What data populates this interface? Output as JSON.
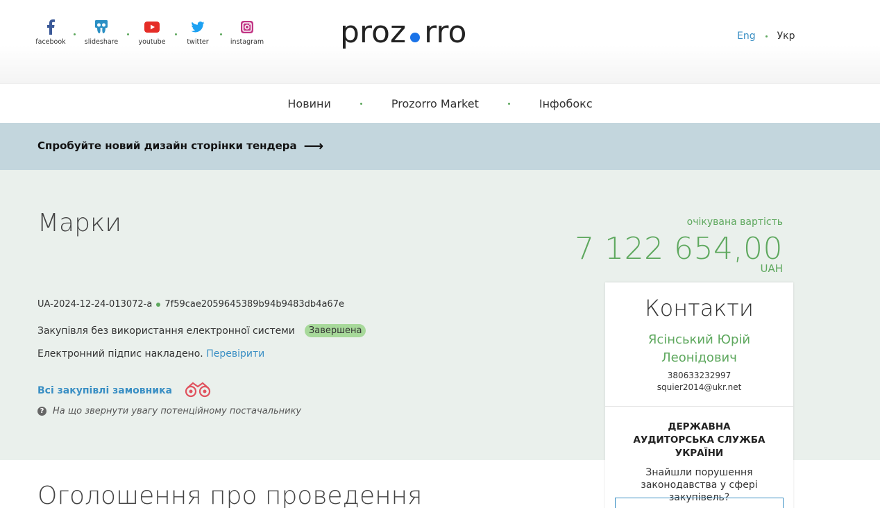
{
  "header": {
    "socials": [
      {
        "name": "facebook",
        "label": "facebook",
        "icon": "facebook-icon",
        "color": "#3b5998"
      },
      {
        "name": "slideshare",
        "label": "slideshare",
        "icon": "slideshare-icon",
        "color": "#2a8fc4"
      },
      {
        "name": "youtube",
        "label": "youtube",
        "icon": "youtube-icon",
        "color": "#e52d27"
      },
      {
        "name": "twitter",
        "label": "twitter",
        "icon": "twitter-icon",
        "color": "#1da1f2"
      },
      {
        "name": "instagram",
        "label": "instagram",
        "icon": "instagram-icon",
        "color": "#c13584"
      }
    ],
    "logo_left": "proz",
    "logo_right": "rro",
    "lang_en": "Eng",
    "lang_uk": "Укр"
  },
  "nav": {
    "items": [
      "Новини",
      "Prozorro Market",
      "Інфобокс"
    ]
  },
  "banner": {
    "text": "Спробуйте новий дизайн сторінки тендера",
    "arrow": "⟶"
  },
  "tender": {
    "title": "Марки",
    "id": "UA-2024-12-24-013072-a",
    "hash": "7f59cae2059645389b94b9483db4a67e",
    "procedure": "Закупівля без використання електронної системи",
    "status": "Завершена",
    "signature_text": "Електронний підпис накладено.",
    "signature_link": "Перевірити",
    "all_procurements": "Всі закупівлі замовника",
    "tip": "На що звернути увагу потенційному постачальнику",
    "expected_label": "очікувана вартість",
    "expected_value": "7 122 654,00",
    "currency": "UAH"
  },
  "contacts": {
    "title": "Контакти",
    "name": "Ясінський Юрій Леонідович",
    "phone": "380633232997",
    "email": "squier2014@ukr.net",
    "dasu_title": "ДЕРЖАВНА АУДИТОРСЬКА СЛУЖБА УКРАЇНИ",
    "dasu_text": "Знайшли порушення законодавства у сфері закупівель?"
  },
  "section": {
    "title": "Оголошення про проведення"
  },
  "colors": {
    "accent_green": "#5ea85e",
    "link_blue": "#3a8fc4",
    "banner_bg": "#c3d6dd",
    "main_bg": "#eaf0ec",
    "logo_dot": "#1a73e8"
  }
}
